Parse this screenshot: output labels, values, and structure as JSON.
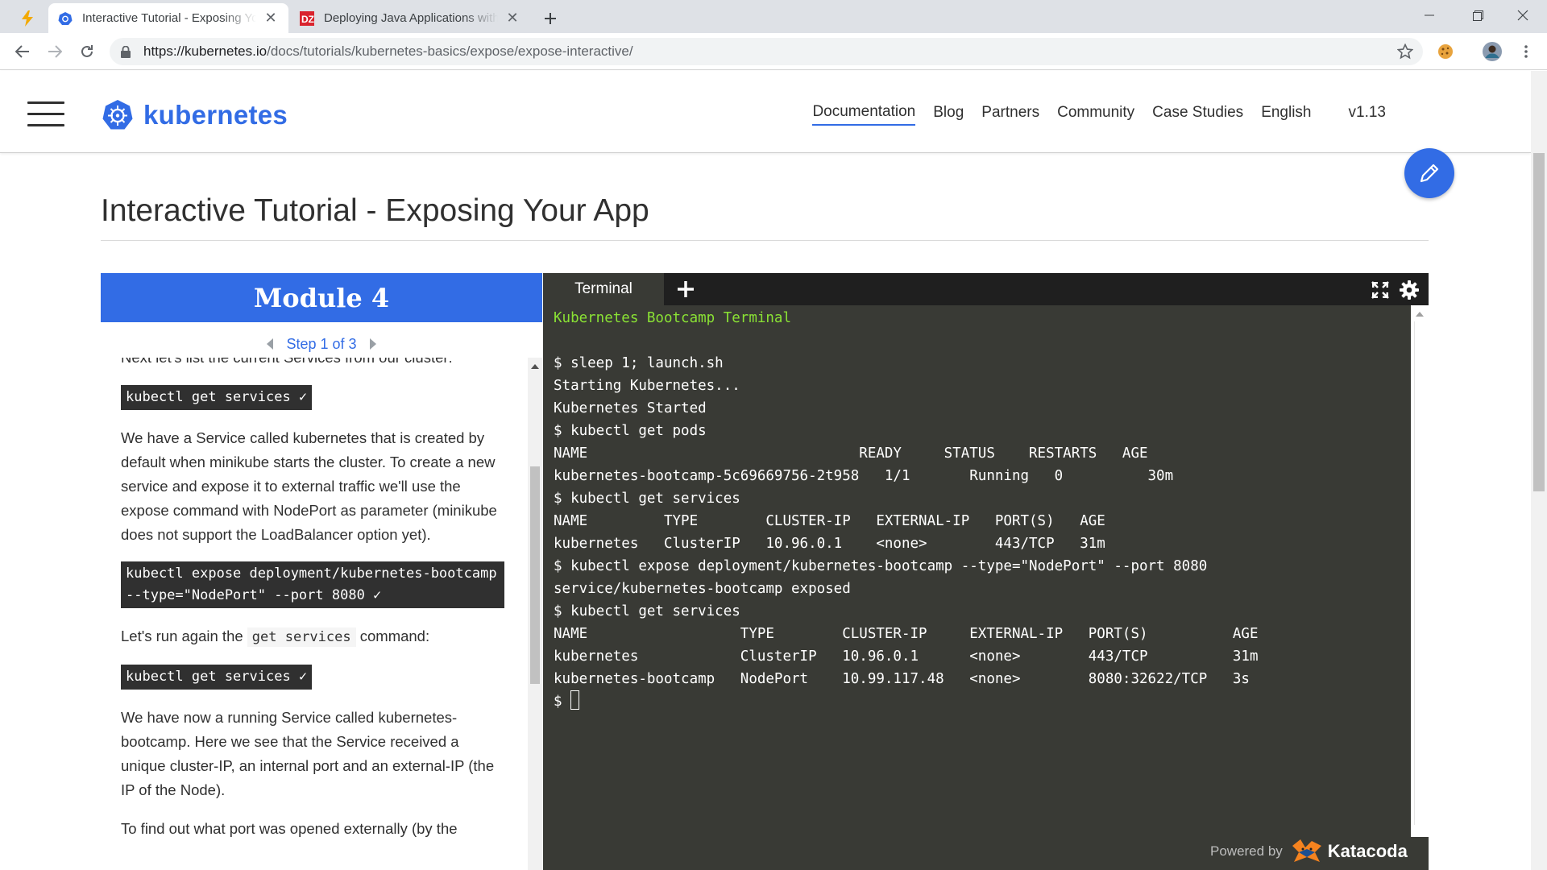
{
  "browser": {
    "tabs": [
      {
        "title": "Interactive Tutorial - Exposing Your App - Kubernetes",
        "active": true
      },
      {
        "title": "Deploying Java Applications with Docker and Kubernetes",
        "active": false
      }
    ],
    "url_host": "https://kubernetes.io",
    "url_path": "/docs/tutorials/kubernetes-basics/expose/expose-interactive/",
    "colors": {
      "tabstrip": "#dee1e6",
      "accent": "#326ce5"
    }
  },
  "site": {
    "logo_text": "kubernetes",
    "nav": {
      "documentation": "Documentation",
      "blog": "Blog",
      "partners": "Partners",
      "community": "Community",
      "case_studies": "Case Studies",
      "language": "English",
      "version": "v1.13"
    }
  },
  "page": {
    "title": "Interactive Tutorial - Exposing Your App"
  },
  "tutorial": {
    "module": "Module 4",
    "step": "Step 1 of 3",
    "partial_top": "Next let's list the current Services from our cluster:",
    "cmd1": "kubectl get services ✓",
    "para1": "We have a Service called kubernetes that is created by default when minikube starts the cluster. To create a new service and expose it to external traffic we'll use the expose command with NodePort as parameter (minikube does not support the LoadBalancer option yet).",
    "cmd2": "kubectl expose deployment/kubernetes-bootcamp\n--type=\"NodePort\" --port 8080 ✓",
    "para2_before": "Let's run again the ",
    "para2_code": "get services",
    "para2_after": " command:",
    "cmd3": "kubectl get services ✓",
    "para3": "We have now a running Service called kubernetes-bootcamp. Here we see that the Service received a unique cluster-IP, an internal port and an external-IP (the IP of the Node).",
    "para4_partial": "To find out what port was opened externally (by the"
  },
  "terminal": {
    "tab_label": "Terminal",
    "banner": "Kubernetes Bootcamp Terminal",
    "lines": [
      "",
      "$ sleep 1; launch.sh",
      "Starting Kubernetes...",
      "Kubernetes Started",
      "$ kubectl get pods",
      "NAME                                READY     STATUS    RESTARTS   AGE",
      "kubernetes-bootcamp-5c69669756-2t958   1/1       Running   0          30m",
      "$ kubectl get services",
      "NAME         TYPE        CLUSTER-IP   EXTERNAL-IP   PORT(S)   AGE",
      "kubernetes   ClusterIP   10.96.0.1    <none>        443/TCP   31m",
      "$ kubectl expose deployment/kubernetes-bootcamp --type=\"NodePort\" --port 8080",
      "service/kubernetes-bootcamp exposed",
      "$ kubectl get services",
      "NAME                  TYPE        CLUSTER-IP     EXTERNAL-IP   PORT(S)          AGE",
      "kubernetes            ClusterIP   10.96.0.1      <none>        443/TCP          31m",
      "kubernetes-bootcamp   NodePort    10.99.117.48   <none>        8080:32622/TCP   3s"
    ],
    "prompt": "$ ",
    "powered_by": "Powered by",
    "brand": "Katacoda",
    "colors": {
      "background": "#393a35",
      "banner": "#8ae234"
    }
  }
}
